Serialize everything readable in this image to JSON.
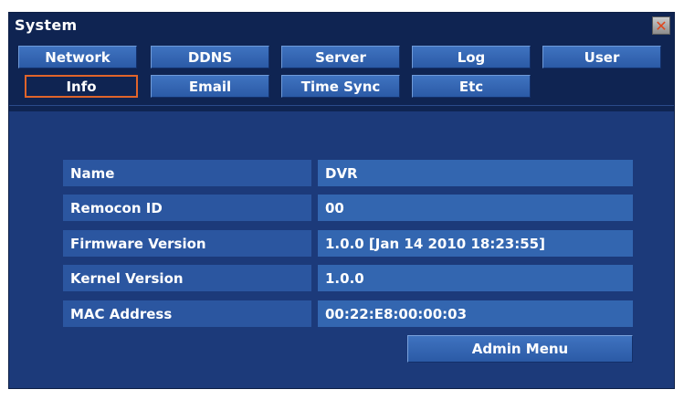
{
  "window": {
    "title": "System",
    "close_icon": "close-icon",
    "close_glyph": "✕"
  },
  "tabs": [
    {
      "label": "Network"
    },
    {
      "label": "DDNS"
    },
    {
      "label": "Server"
    },
    {
      "label": "Log"
    },
    {
      "label": "User"
    },
    {
      "label": "Info",
      "active": true
    },
    {
      "label": "Email"
    },
    {
      "label": "Time Sync"
    },
    {
      "label": "Etc"
    }
  ],
  "info": {
    "rows": [
      {
        "label": "Name",
        "value": "DVR"
      },
      {
        "label": "Remocon ID",
        "value": "00"
      },
      {
        "label": "Firmware Version",
        "value": "1.0.0 [Jan 14 2010 18:23:55]"
      },
      {
        "label": "Kernel Version",
        "value": "1.0.0"
      },
      {
        "label": "MAC Address",
        "value": "00:22:E8:00:00:03"
      }
    ]
  },
  "actions": {
    "admin_menu_label": "Admin Menu"
  },
  "colors": {
    "background": "#1c3a7a",
    "titlebar": "#0f2452",
    "tab": "#2b5aa6",
    "active_tab_border": "#e0642a",
    "close_x": "#e0461c"
  }
}
